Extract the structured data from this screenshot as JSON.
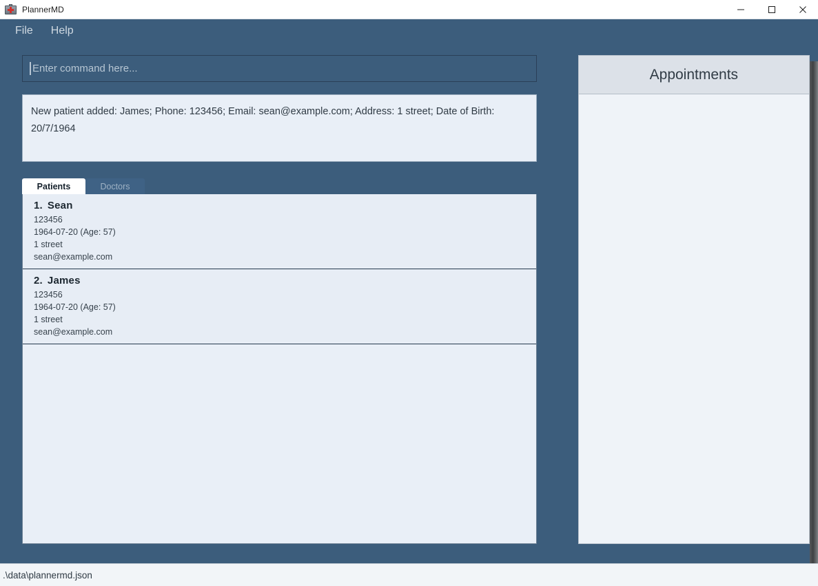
{
  "window": {
    "title": "PlannerMD",
    "icon": "medical-kit-icon",
    "controls": {
      "minimize": "minimize-icon",
      "maximize": "maximize-icon",
      "close": "close-icon"
    }
  },
  "menubar": {
    "items": [
      {
        "label": "File"
      },
      {
        "label": "Help"
      }
    ]
  },
  "command": {
    "placeholder": "Enter command here...",
    "value": ""
  },
  "result": {
    "text": "New patient added: James; Phone: 123456; Email: sean@example.com; Address: 1 street; Date of Birth: 20/7/1964"
  },
  "tabs": [
    {
      "label": "Patients",
      "active": true
    },
    {
      "label": "Doctors",
      "active": false
    }
  ],
  "patients": [
    {
      "index": "1.",
      "name": "Sean",
      "phone": "123456",
      "dob": "1964-07-20 (Age: 57)",
      "address": "1 street",
      "email": "sean@example.com"
    },
    {
      "index": "2.",
      "name": "James",
      "phone": "123456",
      "dob": "1964-07-20 (Age: 57)",
      "address": "1 street",
      "email": "sean@example.com"
    }
  ],
  "appointments": {
    "title": "Appointments",
    "items": []
  },
  "statusbar": {
    "path": ".\\data\\plannermd.json"
  },
  "colors": {
    "app_background": "#3c5d7c",
    "panel_light": "#e9eff7",
    "panel_header": "#dce1e8",
    "accent_cross": "#d0312d",
    "status_background": "#f2f5f8"
  }
}
